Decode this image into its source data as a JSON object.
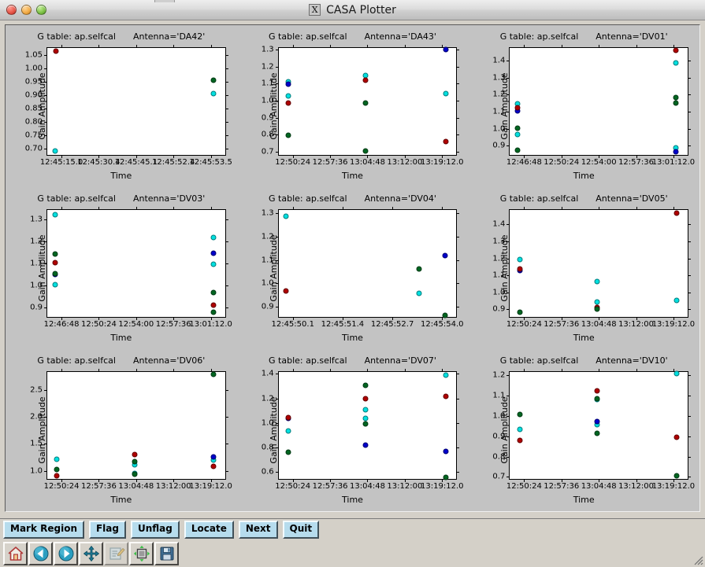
{
  "window": {
    "title": "CASA Plotter",
    "x_logo": "X",
    "controls": [
      {
        "name": "close",
        "color": "#e8584b"
      },
      {
        "name": "minimize",
        "color": "#f2ad4a"
      },
      {
        "name": "zoom",
        "color": "#81c44a"
      }
    ]
  },
  "colors": {
    "series_cyan": "#00e0e0",
    "series_blue": "#0000cc",
    "series_red": "#b00000",
    "series_green": "#006622",
    "panel_bg": "#c3c3c3",
    "plot_bg": "#ffffff",
    "button_face": "#b6dced",
    "window_bg": "#d4d0c8"
  },
  "toolbar": {
    "buttons": [
      {
        "label": "Mark Region",
        "name": "mark-region-button"
      },
      {
        "label": "Flag",
        "name": "flag-button"
      },
      {
        "label": "Unflag",
        "name": "unflag-button"
      },
      {
        "label": "Locate",
        "name": "locate-button"
      },
      {
        "label": "Next",
        "name": "next-button"
      },
      {
        "label": "Quit",
        "name": "quit-button"
      }
    ],
    "icons": [
      {
        "name": "home-icon",
        "title": "Home"
      },
      {
        "name": "back-arrow-icon",
        "title": "Back"
      },
      {
        "name": "forward-arrow-icon",
        "title": "Forward"
      },
      {
        "name": "pan-move-icon",
        "title": "Pan"
      },
      {
        "name": "configure-subplots-icon",
        "title": "Configure subplots"
      },
      {
        "name": "zoom-to-rect-icon",
        "title": "Zoom to rectangle"
      },
      {
        "name": "save-icon",
        "title": "Save figure"
      }
    ]
  },
  "chart_data": [
    {
      "type": "scatter",
      "title_prefix": "G table: ap.selfcal",
      "title_suffix": "Antenna='DA42'",
      "antenna": "DA42",
      "xlabel": "Time",
      "ylabel": "Gain Amplitude",
      "yticks": [
        "0.70",
        "0.75",
        "0.80",
        "0.85",
        "0.90",
        "0.95",
        "1.00",
        "1.05"
      ],
      "ytick_values": [
        0.7,
        0.75,
        0.8,
        0.85,
        0.9,
        0.95,
        1.0,
        1.05
      ],
      "ylim": [
        0.675,
        1.075
      ],
      "xticks": [
        "12:45:15.0",
        "12:45:30.4",
        "12:45:45.1",
        "12:45:52.4",
        "12:45:53.5"
      ],
      "xlim": [
        0,
        1
      ],
      "grid": false,
      "series": [
        {
          "name": "cyan",
          "color": "#00e0e0",
          "points": [
            [
              0.045,
              0.69
            ],
            [
              0.935,
              0.905
            ]
          ]
        },
        {
          "name": "red",
          "color": "#b00000",
          "points": [
            [
              0.05,
              1.062
            ]
          ]
        },
        {
          "name": "green",
          "color": "#006622",
          "points": [
            [
              0.935,
              0.955
            ]
          ]
        }
      ]
    },
    {
      "type": "scatter",
      "title_prefix": "G table: ap.selfcal",
      "title_suffix": "Antenna='DA43'",
      "antenna": "DA43",
      "xlabel": "Time",
      "ylabel": "Gain Amplitude",
      "yticks": [
        "0.7",
        "0.8",
        "0.9",
        "1.0",
        "1.1",
        "1.2",
        "1.3"
      ],
      "ytick_values": [
        0.7,
        0.8,
        0.9,
        1.0,
        1.1,
        1.2,
        1.3
      ],
      "ylim": [
        0.68,
        1.31
      ],
      "xticks": [
        "12:50:24",
        "12:57:36",
        "13:04:48",
        "13:12:00",
        "13:19:12.0"
      ],
      "xlim": [
        0,
        1
      ],
      "grid": false,
      "series": [
        {
          "name": "cyan",
          "color": "#00e0e0",
          "points": [
            [
              0.055,
              1.112
            ],
            [
              0.055,
              1.028
            ],
            [
              0.49,
              1.148
            ],
            [
              0.94,
              1.042
            ]
          ]
        },
        {
          "name": "blue",
          "color": "#0000cc",
          "points": [
            [
              0.055,
              1.098
            ],
            [
              0.94,
              1.3
            ]
          ]
        },
        {
          "name": "red",
          "color": "#b00000",
          "points": [
            [
              0.055,
              0.988
            ],
            [
              0.49,
              1.122
            ],
            [
              0.94,
              0.76
            ]
          ]
        },
        {
          "name": "green",
          "color": "#006622",
          "points": [
            [
              0.055,
              0.798
            ],
            [
              0.49,
              0.988
            ],
            [
              0.49,
              0.705
            ]
          ]
        }
      ]
    },
    {
      "type": "scatter",
      "title_prefix": "G table: ap.selfcal",
      "title_suffix": "Antenna='DV01'",
      "antenna": "DV01",
      "xlabel": "Time",
      "ylabel": "Gain Amplitude",
      "yticks": [
        "0.9",
        "1.0",
        "1.1",
        "1.2",
        "1.3",
        "1.4"
      ],
      "ytick_values": [
        0.9,
        1.0,
        1.1,
        1.2,
        1.3,
        1.4
      ],
      "ylim": [
        0.845,
        1.475
      ],
      "xticks": [
        "12:46:48",
        "12:50:24",
        "12:54:00",
        "12:57:36",
        "13:01:12.0"
      ],
      "xlim": [
        0,
        1
      ],
      "grid": false,
      "series": [
        {
          "name": "cyan",
          "color": "#00e0e0",
          "points": [
            [
              0.045,
              1.148
            ],
            [
              0.045,
              0.965
            ],
            [
              0.935,
              1.385
            ],
            [
              0.935,
              0.885
            ]
          ]
        },
        {
          "name": "blue",
          "color": "#0000cc",
          "points": [
            [
              0.045,
              1.105
            ],
            [
              0.935,
              0.862
            ]
          ]
        },
        {
          "name": "red",
          "color": "#b00000",
          "points": [
            [
              0.045,
              1.122
            ],
            [
              0.935,
              1.462
            ]
          ]
        },
        {
          "name": "green",
          "color": "#006622",
          "points": [
            [
              0.045,
              1.002
            ],
            [
              0.045,
              0.872
            ],
            [
              0.935,
              1.185
            ],
            [
              0.935,
              1.15
            ]
          ]
        }
      ]
    },
    {
      "type": "scatter",
      "title_prefix": "G table: ap.selfcal",
      "title_suffix": "Antenna='DV03'",
      "antenna": "DV03",
      "xlabel": "Time",
      "ylabel": "Gain Amplitude",
      "yticks": [
        "0.9",
        "1.0",
        "1.1",
        "1.2",
        "1.3"
      ],
      "ytick_values": [
        0.9,
        1.0,
        1.1,
        1.2,
        1.3
      ],
      "ylim": [
        0.855,
        1.345
      ],
      "xticks": [
        "12:46:48",
        "12:50:24",
        "12:54:00",
        "12:57:36",
        "13:01:12.0"
      ],
      "xlim": [
        0,
        1
      ],
      "grid": false,
      "series": [
        {
          "name": "cyan",
          "color": "#00e0e0",
          "points": [
            [
              0.045,
              1.325
            ],
            [
              0.045,
              1.002
            ],
            [
              0.935,
              1.22
            ],
            [
              0.935,
              1.098
            ]
          ]
        },
        {
          "name": "blue",
          "color": "#0000cc",
          "points": [
            [
              0.045,
              1.048
            ],
            [
              0.935,
              1.148
            ]
          ]
        },
        {
          "name": "red",
          "color": "#b00000",
          "points": [
            [
              0.045,
              1.105
            ],
            [
              0.935,
              0.908
            ]
          ]
        },
        {
          "name": "green",
          "color": "#006622",
          "points": [
            [
              0.045,
              1.142
            ],
            [
              0.045,
              1.052
            ],
            [
              0.935,
              0.965
            ],
            [
              0.935,
              0.878
            ]
          ]
        }
      ]
    },
    {
      "type": "scatter",
      "title_prefix": "G table: ap.selfcal",
      "title_suffix": "Antenna='DV04'",
      "antenna": "DV04",
      "xlabel": "Time",
      "ylabel": "Gain Amplitude",
      "yticks": [
        "0.9",
        "1.0",
        "1.1",
        "1.2",
        "1.3"
      ],
      "ytick_values": [
        0.9,
        1.0,
        1.1,
        1.2,
        1.3
      ],
      "ylim": [
        0.855,
        1.315
      ],
      "xticks": [
        "12:45:50.1",
        "12:45:51.4",
        "12:45:52.7",
        "12:45:54.0"
      ],
      "xlim": [
        0,
        1
      ],
      "grid": false,
      "series": [
        {
          "name": "cyan",
          "color": "#00e0e0",
          "points": [
            [
              0.04,
              1.288
            ],
            [
              0.79,
              0.958
            ]
          ]
        },
        {
          "name": "blue",
          "color": "#0000cc",
          "points": [
            [
              0.935,
              1.118
            ]
          ]
        },
        {
          "name": "red",
          "color": "#b00000",
          "points": [
            [
              0.04,
              0.968
            ]
          ]
        },
        {
          "name": "green",
          "color": "#006622",
          "points": [
            [
              0.79,
              1.06
            ],
            [
              0.935,
              0.862
            ]
          ]
        }
      ]
    },
    {
      "type": "scatter",
      "title_prefix": "G table: ap.selfcal",
      "title_suffix": "Antenna='DV05'",
      "antenna": "DV05",
      "xlabel": "Time",
      "ylabel": "Gain Amplitude",
      "yticks": [
        "0.9",
        "1.0",
        "1.1",
        "1.2",
        "1.3",
        "1.4"
      ],
      "ytick_values": [
        0.9,
        1.0,
        1.1,
        1.2,
        1.3,
        1.4
      ],
      "ylim": [
        0.855,
        1.485
      ],
      "xticks": [
        "12:50:24",
        "12:57:36",
        "13:04:48",
        "13:12:00",
        "13:19:12.0"
      ],
      "xlim": [
        0,
        1
      ],
      "grid": false,
      "series": [
        {
          "name": "cyan",
          "color": "#00e0e0",
          "points": [
            [
              0.055,
              1.192
            ],
            [
              0.49,
              1.065
            ],
            [
              0.49,
              0.945
            ],
            [
              0.94,
              0.952
            ]
          ]
        },
        {
          "name": "blue",
          "color": "#0000cc",
          "points": [
            [
              0.055,
              1.128
            ]
          ]
        },
        {
          "name": "red",
          "color": "#b00000",
          "points": [
            [
              0.055,
              1.138
            ],
            [
              0.49,
              0.912
            ],
            [
              0.94,
              1.465
            ]
          ]
        },
        {
          "name": "green",
          "color": "#006622",
          "points": [
            [
              0.055,
              0.885
            ],
            [
              0.49,
              0.902
            ]
          ]
        }
      ]
    },
    {
      "type": "scatter",
      "title_prefix": "G table: ap.selfcal",
      "title_suffix": "Antenna='DV06'",
      "antenna": "DV06",
      "xlabel": "Time",
      "ylabel": "Gain Amplitude",
      "yticks": [
        "1.0",
        "1.5",
        "2.0",
        "2.5"
      ],
      "ytick_values": [
        1.0,
        1.5,
        2.0,
        2.5
      ],
      "ylim": [
        0.85,
        2.83
      ],
      "xticks": [
        "12:50:24",
        "12:57:36",
        "13:04:48",
        "13:12:00",
        "13:19:12.0"
      ],
      "xlim": [
        0,
        1
      ],
      "grid": false,
      "series": [
        {
          "name": "cyan",
          "color": "#00e0e0",
          "points": [
            [
              0.055,
              1.215
            ],
            [
              0.49,
              1.105
            ],
            [
              0.49,
              0.955
            ],
            [
              0.935,
              1.195
            ]
          ]
        },
        {
          "name": "blue",
          "color": "#0000cc",
          "points": [
            [
              0.935,
              1.255
            ]
          ]
        },
        {
          "name": "red",
          "color": "#b00000",
          "points": [
            [
              0.055,
              0.905
            ],
            [
              0.49,
              1.305
            ],
            [
              0.935,
              1.085
            ]
          ]
        },
        {
          "name": "green",
          "color": "#006622",
          "points": [
            [
              0.055,
              1.025
            ],
            [
              0.49,
              1.175
            ],
            [
              0.49,
              0.94
            ],
            [
              0.935,
              2.79
            ]
          ]
        }
      ]
    },
    {
      "type": "scatter",
      "title_prefix": "G table: ap.selfcal",
      "title_suffix": "Antenna='DV07'",
      "antenna": "DV07",
      "xlabel": "Time",
      "ylabel": "Gain Amplitude",
      "yticks": [
        "0.6",
        "0.8",
        "1.0",
        "1.2",
        "1.4"
      ],
      "ytick_values": [
        0.6,
        0.8,
        1.0,
        1.2,
        1.4
      ],
      "ylim": [
        0.545,
        1.415
      ],
      "xticks": [
        "12:50:24",
        "12:57:36",
        "13:04:48",
        "13:12:00",
        "13:19:12.0"
      ],
      "xlim": [
        0,
        1
      ],
      "grid": false,
      "series": [
        {
          "name": "cyan",
          "color": "#00e0e0",
          "points": [
            [
              0.055,
              0.935
            ],
            [
              0.49,
              1.105
            ],
            [
              0.49,
              1.038
            ],
            [
              0.94,
              1.39
            ]
          ]
        },
        {
          "name": "blue",
          "color": "#0000cc",
          "points": [
            [
              0.055,
              1.04
            ],
            [
              0.49,
              0.822
            ],
            [
              0.94,
              0.772
            ]
          ]
        },
        {
          "name": "red",
          "color": "#b00000",
          "points": [
            [
              0.055,
              1.042
            ],
            [
              0.49,
              1.198
            ],
            [
              0.94,
              1.218
            ]
          ]
        },
        {
          "name": "green",
          "color": "#006622",
          "points": [
            [
              0.055,
              0.76
            ],
            [
              0.49,
              1.308
            ],
            [
              0.49,
              0.99
            ],
            [
              0.94,
              0.558
            ]
          ]
        }
      ]
    },
    {
      "type": "scatter",
      "title_prefix": "G table: ap.selfcal",
      "title_suffix": "Antenna='DV10'",
      "antenna": "DV10",
      "xlabel": "Time",
      "ylabel": "Gain Amplitude",
      "yticks": [
        "0.7",
        "0.8",
        "0.9",
        "1.0",
        "1.1",
        "1.2"
      ],
      "ytick_values": [
        0.7,
        0.8,
        0.9,
        1.0,
        1.1,
        1.2
      ],
      "ylim": [
        0.69,
        1.215
      ],
      "xticks": [
        "12:50:24",
        "12:57:36",
        "13:04:48",
        "13:12:00",
        "13:19:12.0"
      ],
      "xlim": [
        0,
        1
      ],
      "grid": false,
      "series": [
        {
          "name": "cyan",
          "color": "#00e0e0",
          "points": [
            [
              0.055,
              0.935
            ],
            [
              0.49,
              1.078
            ],
            [
              0.49,
              0.955
            ],
            [
              0.94,
              1.208
            ]
          ]
        },
        {
          "name": "blue",
          "color": "#0000cc",
          "points": [
            [
              0.49,
              0.972
            ]
          ]
        },
        {
          "name": "red",
          "color": "#b00000",
          "points": [
            [
              0.055,
              0.878
            ],
            [
              0.49,
              1.122
            ],
            [
              0.94,
              0.895
            ]
          ]
        },
        {
          "name": "green",
          "color": "#006622",
          "points": [
            [
              0.055,
              1.008
            ],
            [
              0.49,
              1.082
            ],
            [
              0.49,
              0.912
            ],
            [
              0.94,
              0.705
            ]
          ]
        }
      ]
    }
  ]
}
